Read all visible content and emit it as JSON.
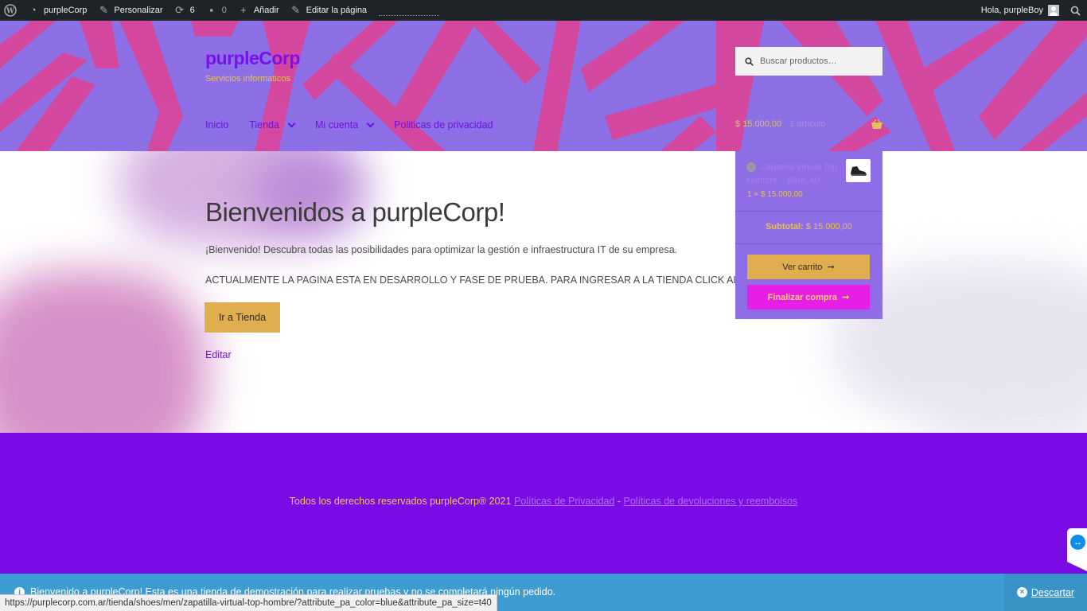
{
  "adminbar": {
    "site_name": "purpleCorp",
    "customize": "Personalizar",
    "updates_count": "6",
    "comments_count": "0",
    "add_new": "Añadir",
    "edit_page": "Editar la página",
    "greeting": "Hola, purpleBoy"
  },
  "header": {
    "site_title": "purpleCorp",
    "site_description": "Servicios informaticos",
    "search_placeholder": "Buscar productos…",
    "nav": [
      "Inicio",
      "Tienda",
      "Mi cuenta",
      "Politicas de privacidad"
    ],
    "cart_total": "$ 15.000,00",
    "cart_items": "1 artículo"
  },
  "mini_cart": {
    "item_name": "Zapatilla Virtual Top Hombre – Blue, 40",
    "item_qty": "1 × $ 15.000,00",
    "subtotal_label": "Subtotal:",
    "subtotal_value": "$ 15.000,00",
    "view_cart": "Ver carrito",
    "checkout": "Finalizar compra"
  },
  "main": {
    "title": "Bienvenidos a purpleCorp!",
    "paragraph1": "¡Bienvenido! Descubra todas las posibilidades para optimizar la gestión e infraestructura IT de su empresa.",
    "paragraph2": "ACTUALMENTE LA PAGINA ESTA EN DESARROLLO Y FASE DE PRUEBA. PARA INGRESAR A LA TIENDA CLICK AL BOTON.",
    "button": "Ir a Tienda",
    "edit": "Editar"
  },
  "footer": {
    "copyright": "Todos los derechos reservados purpleCorp® 2021",
    "privacy_link": "Políticas de Privacidad",
    "separator": " - ",
    "returns_link": "Políticas de devoluciones y reembolsos"
  },
  "store_notice": {
    "text": "Bienvenido a purpleCorp! Esta es una tienda de demostración para realizar pruebas y no se completará ningún pedido.",
    "dismiss": "Descartar"
  },
  "status_url": "https://purplecorp.com.ar/tienda/shoes/men/zapatilla-virtual-top-hombre/?attribute_pa_color=blue&attribute_pa_size=t40",
  "colors": {
    "admin_bar": "#1d2327",
    "header_bg": "#8d6fe6",
    "accent_purple": "#7a0ae6",
    "accent_gold": "#e0ad4f",
    "checkout_magenta": "#e61ee6",
    "notice_blue": "#3d9cd2"
  },
  "icons": [
    "wordpress-icon",
    "dashboard-icon",
    "brush-icon",
    "updates-icon",
    "comment-icon",
    "plus-icon",
    "pencil-icon",
    "avatar-icon",
    "search-icon",
    "chevron-down-icon",
    "basket-icon",
    "remove-icon",
    "shoe-icon",
    "arrow-right-icon",
    "info-icon",
    "close-icon",
    "teamviewer-icon"
  ]
}
